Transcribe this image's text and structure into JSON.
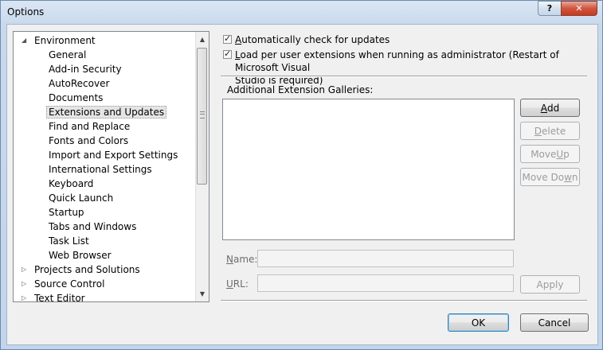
{
  "window": {
    "title": "Options",
    "help_glyph": "?",
    "close_glyph": "✕"
  },
  "tree": {
    "items": [
      {
        "label": "Environment",
        "expander": "◢"
      },
      {
        "label": "General"
      },
      {
        "label": "Add-in Security"
      },
      {
        "label": "AutoRecover"
      },
      {
        "label": "Documents"
      },
      {
        "label": "Extensions and Updates"
      },
      {
        "label": "Find and Replace"
      },
      {
        "label": "Fonts and Colors"
      },
      {
        "label": "Import and Export Settings"
      },
      {
        "label": "International Settings"
      },
      {
        "label": "Keyboard"
      },
      {
        "label": "Quick Launch"
      },
      {
        "label": "Startup"
      },
      {
        "label": "Tabs and Windows"
      },
      {
        "label": "Task List"
      },
      {
        "label": "Web Browser"
      },
      {
        "label": "Projects and Solutions",
        "expander": "▷"
      },
      {
        "label": "Source Control",
        "expander": "▷"
      },
      {
        "label": "Text Editor",
        "expander": "▷"
      }
    ],
    "selected": "Extensions and Updates",
    "scroll_up": "▲",
    "scroll_down": "▼"
  },
  "options": {
    "auto_check": {
      "checked": true,
      "label_key": "A",
      "label_rest": "utomatically check for updates"
    },
    "load_per_user": {
      "checked": true,
      "label_key": "L",
      "label_rest": "oad per user extensions when running as administrator (Restart of Microsoft Visual",
      "label_line2": "Studio is required)"
    }
  },
  "galleries": {
    "label": "Additional Extension Galleries:",
    "items": []
  },
  "buttons": {
    "add": {
      "key": "A",
      "rest": "dd"
    },
    "delete": {
      "key": "D",
      "rest": "elete"
    },
    "move_up": {
      "pre": "Move ",
      "key": "U",
      "rest": "p"
    },
    "move_down": {
      "pre": "Move Do",
      "key": "w",
      "rest": "n"
    },
    "apply": "Apply",
    "ok": "OK",
    "cancel": "Cancel"
  },
  "fields": {
    "name": {
      "key": "N",
      "rest": "ame:",
      "value": ""
    },
    "url": {
      "key": "U",
      "rest": "RL:",
      "value": ""
    }
  }
}
